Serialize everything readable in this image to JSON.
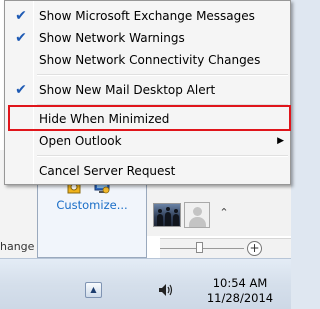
{
  "context_menu": {
    "items": [
      {
        "label": "Show Microsoft Exchange Messages",
        "checked": true
      },
      {
        "label": "Show Network Warnings",
        "checked": true
      },
      {
        "label": "Show Network Connectivity Changes",
        "checked": false
      },
      {
        "label": "Show New Mail Desktop Alert",
        "checked": true
      },
      {
        "label": "Hide When Minimized",
        "checked": false,
        "highlighted": true
      },
      {
        "label": "Open Outlook",
        "checked": false,
        "has_submenu": true
      },
      {
        "label": "Cancel Server Request",
        "checked": false
      }
    ],
    "highlight_color": "#e0151b"
  },
  "overflow_area": {
    "customize_label": "Customize..."
  },
  "background_window": {
    "status_text": "hange"
  },
  "taskbar": {
    "time": "10:54 AM",
    "date": "11/28/2014"
  },
  "icons": {
    "check": "checkmark-icon",
    "submenu": "submenu-arrow-icon",
    "outlook": "outlook-tray-icon",
    "network": "network-tray-icon",
    "volume": "volume-icon",
    "show_hidden": "show-hidden-icons-arrow"
  }
}
